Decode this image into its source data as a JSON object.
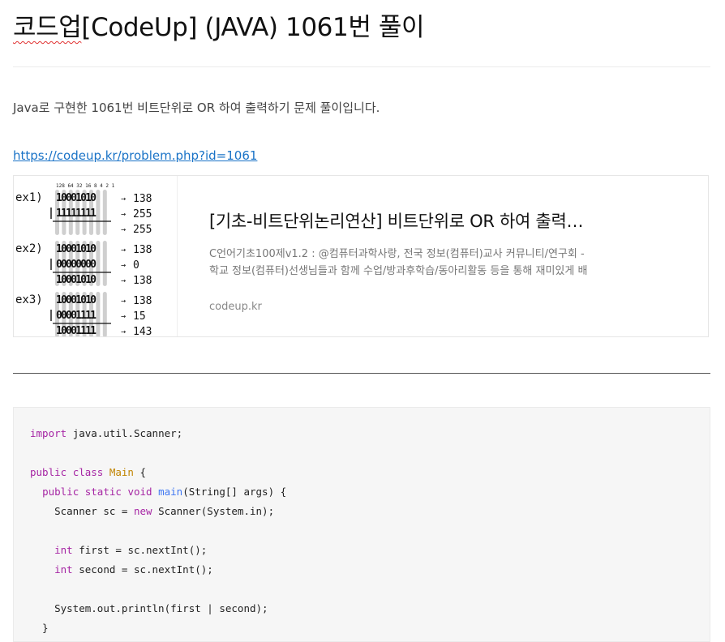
{
  "post": {
    "title_prefix": "코드업",
    "title_rest": "[CodeUp] (JAVA) 1061번 풀이",
    "intro": "Java로 구현한 1061번 비트단위로 OR 하여 출력하기 문제 풀이입니다.",
    "link": "https://codeup.kr/problem.php?id=1061"
  },
  "card": {
    "title": "[기초-비트단위논리연산] 비트단위로 OR 하여 출력하기",
    "description": "C언어기초100제v1.2 : @컴퓨터과학사랑, 전국 정보(컴퓨터)교사 커뮤니티/연구회 - 학교 정보(컴퓨터)선생님들과 함께 수업/방과후학습/동아리활동 등을 통해 재미있게 배워보세요.",
    "domain": "codeup.kr",
    "thumbnail": {
      "header": "128 64 32 16 8 4 2 1",
      "examples": [
        {
          "label": "ex1)",
          "rows": [
            {
              "bits": "10001010",
              "value": "138"
            },
            {
              "bits": "11111111",
              "value": "255"
            },
            {
              "bits": "",
              "value": "255"
            }
          ]
        },
        {
          "label": "ex2)",
          "rows": [
            {
              "bits": "10001010",
              "value": "138"
            },
            {
              "bits": "00000000",
              "value": "0"
            },
            {
              "bits": "10001010",
              "value": "138"
            }
          ]
        },
        {
          "label": "ex3)",
          "rows": [
            {
              "bits": "10001010",
              "value": "138"
            },
            {
              "bits": "00001111",
              "value": "15"
            },
            {
              "bits": "10001111",
              "value": "143"
            }
          ]
        }
      ]
    }
  },
  "code": {
    "language": "java",
    "lines": [
      "import java.util.Scanner;",
      "",
      "public class Main {",
      "  public static void main(String[] args) {",
      "    Scanner sc = new Scanner(System.in);",
      "",
      "    int first = sc.nextInt();",
      "    int second = sc.nextInt();",
      "",
      "    System.out.println(first | second);",
      "  }"
    ]
  }
}
